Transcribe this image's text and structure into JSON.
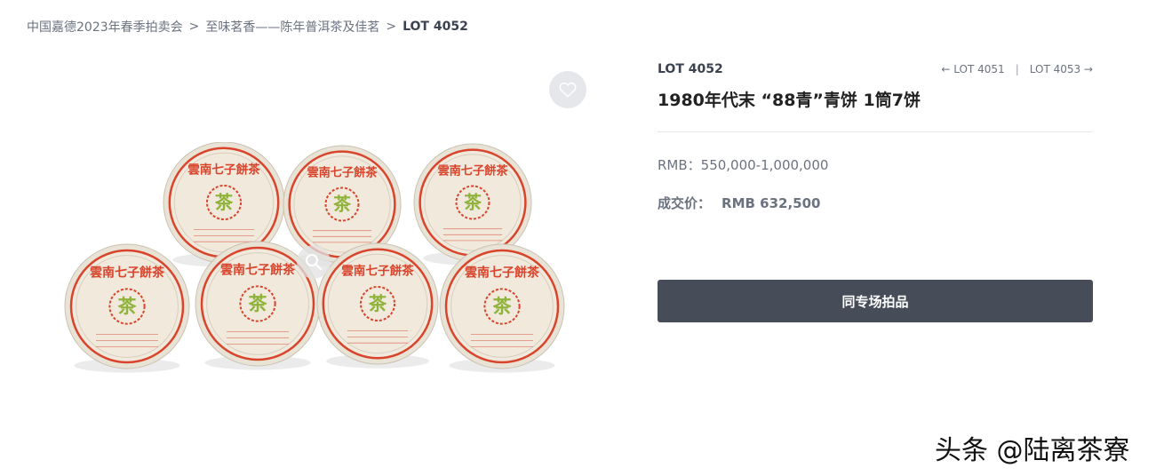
{
  "breadcrumb": {
    "items": [
      "中国嘉德2023年春季拍卖会",
      "至味茗香——陈年普洱茶及佳茗"
    ],
    "separator": ">",
    "current": "LOT 4052"
  },
  "gallery": {
    "favorite_icon": "heart-outline-icon",
    "zoom_icon": "magnifier-icon",
    "cake_text": "雲南七子餅茶",
    "center_mark": "茶"
  },
  "lot": {
    "number": "LOT 4052",
    "prev": "← LOT 4051",
    "divider": "|",
    "next": "LOT 4053 →",
    "title": "1980年代末 “88青”青饼 1筒7饼",
    "estimate": "RMB：550,000-1,000,000",
    "sold_label": "成交价：",
    "sold_value": "RMB 632,500",
    "session_button": "同专场拍品"
  },
  "watermark": "头条 @陆离茶寮",
  "colors": {
    "button": "#464d59",
    "muted": "#6b7280",
    "heading": "#3b4350",
    "wrapper_red": "#d9442c",
    "mark_green": "#8fb33a"
  }
}
